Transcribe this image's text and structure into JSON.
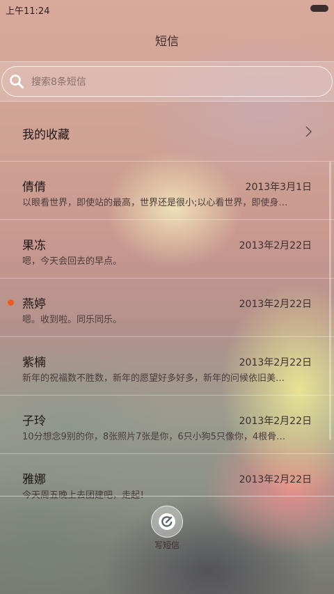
{
  "status_bar": {
    "time": "上午11:24"
  },
  "header": {
    "title": "短信"
  },
  "search": {
    "placeholder": "搜索8条短信"
  },
  "favorites": {
    "label": "我的收藏"
  },
  "conversations": [
    {
      "name": "倩倩",
      "date": "2013年3月1日",
      "preview": "以眼看世界，即使站的最高，世界还是很小;以心看世界，即使身…",
      "unread": false
    },
    {
      "name": "果冻",
      "date": "2013年2月22日",
      "preview": "嗯，今天会回去的早点。",
      "unread": false
    },
    {
      "name": "燕婷",
      "date": "2013年2月22日",
      "preview": "嗯。收到啦。同乐同乐。",
      "unread": true
    },
    {
      "name": "紫楠",
      "date": "2013年2月22日",
      "preview": "新年的祝福数不胜数，新年的愿望好多好多，新年的问候依旧美…",
      "unread": false
    },
    {
      "name": "子玲",
      "date": "2013年2月22日",
      "preview": "10分想念9别的你，8张照片7张是你，6只小狗5只像你，4根骨…",
      "unread": false
    },
    {
      "name": "雅娜",
      "date": "2013年2月22日",
      "preview": "今天周五晚上去团建吧，走起！",
      "unread": false
    }
  ],
  "compose": {
    "label": "写短信",
    "icon": "compose-icon"
  },
  "colors": {
    "unread_dot": "#f05a22"
  }
}
